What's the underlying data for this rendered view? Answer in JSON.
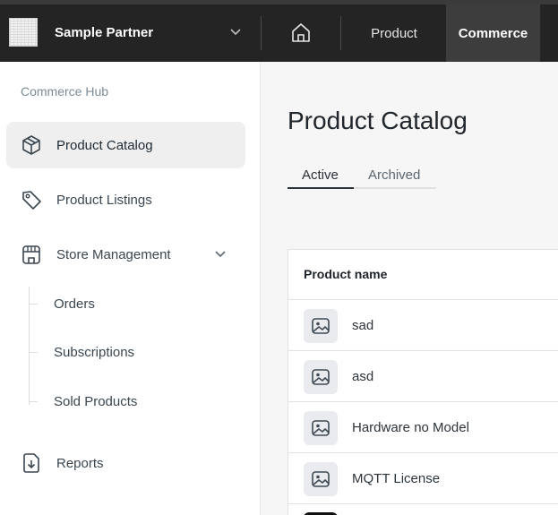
{
  "topbar": {
    "partner_name": "Sample Partner",
    "nav": [
      {
        "label": "Product"
      },
      {
        "label": "Commerce"
      }
    ],
    "accent": "#6c7cf5"
  },
  "sidebar": {
    "hub_title": "Commerce Hub",
    "items": [
      {
        "label": "Product Catalog",
        "icon": "box-icon"
      },
      {
        "label": "Product Listings",
        "icon": "tag-icon"
      },
      {
        "label": "Store Management",
        "icon": "store-icon"
      },
      {
        "label": "Reports",
        "icon": "report-icon"
      }
    ],
    "sub_items": [
      {
        "label": "Orders"
      },
      {
        "label": "Subscriptions"
      },
      {
        "label": "Sold Products"
      }
    ]
  },
  "main": {
    "title": "Product Catalog",
    "tabs": [
      {
        "label": "Active"
      },
      {
        "label": "Archived"
      }
    ],
    "table": {
      "header": "Product name",
      "rows": [
        {
          "name": "sad"
        },
        {
          "name": "asd"
        },
        {
          "name": "Hardware no Model"
        },
        {
          "name": "MQTT License"
        }
      ]
    }
  }
}
